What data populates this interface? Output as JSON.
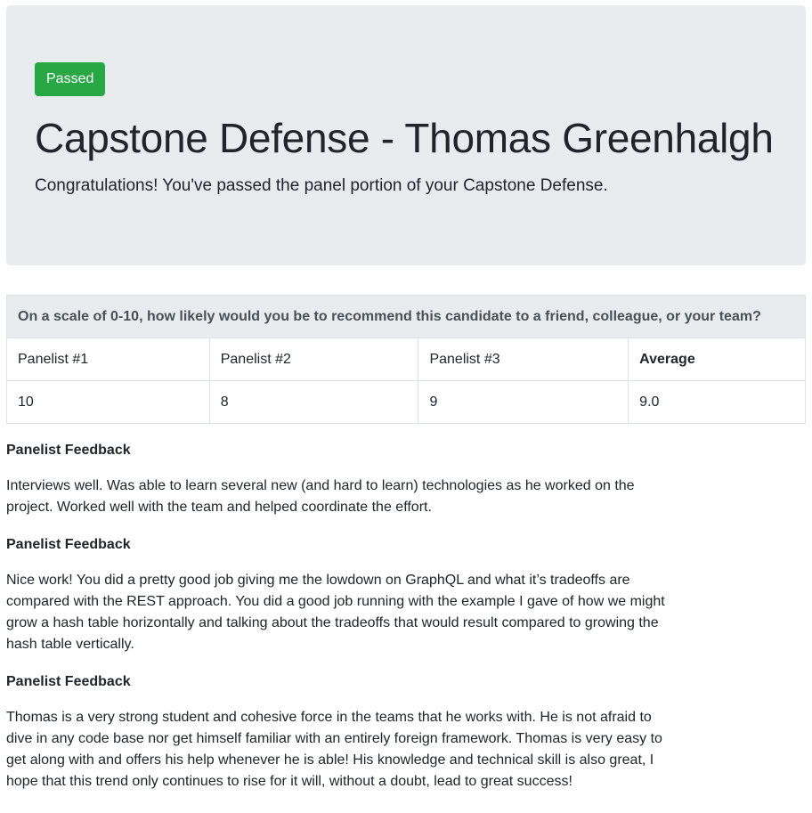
{
  "hero": {
    "badge": "Passed",
    "title": "Capstone Defense - Thomas Greenhalgh",
    "lead_strong": "Congratulations!",
    "lead_text": " You've passed the panel portion of your Capstone Defense."
  },
  "scores": {
    "question": "On a scale of 0-10, how likely would you be to recommend this candidate to a friend, colleague, or your team?",
    "headers": [
      "Panelist #1",
      "Panelist #2",
      "Panelist #3",
      "Average"
    ],
    "values": [
      "10",
      "8",
      "9",
      "9.0"
    ]
  },
  "feedback": [
    {
      "heading": "Panelist Feedback",
      "body": "Interviews well. Was able to learn several new (and hard to learn) technologies as he worked on the project. Worked well with the team and helped coordinate the effort."
    },
    {
      "heading": "Panelist Feedback",
      "body": "Nice work! You did a pretty good job giving me the lowdown on GraphQL and what it’s tradeoffs are compared with the REST approach. You did a good job running with the example I gave of how we might grow a hash table horizontally and talking about the tradeoffs that would result compared to growing the hash table vertically."
    },
    {
      "heading": "Panelist Feedback",
      "body": "Thomas is a very strong student and cohesive force in the teams that he works with. He is not afraid to dive in any code base nor get himself familiar with an entirely foreign framework. Thomas is very easy to get along with and offers his help whenever he is able! His knowledge and technical skill is also great, I hope that this trend only continues to rise for it will, without a doubt, lead to great success!"
    }
  ],
  "colors": {
    "badge": "#28a745",
    "hero_bg": "#e9ecef",
    "text": "#212529"
  }
}
